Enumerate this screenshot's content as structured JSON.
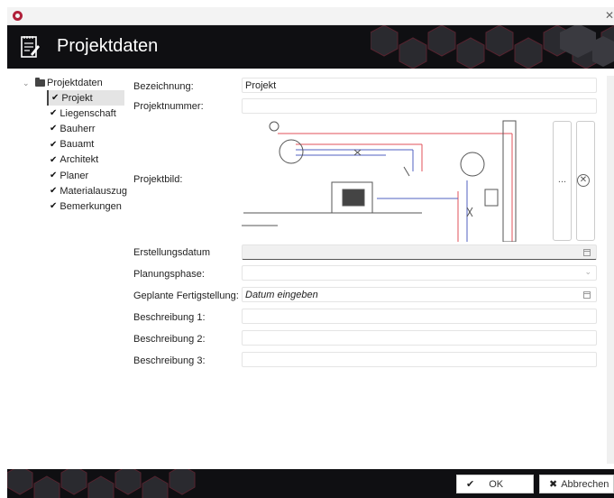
{
  "window": {
    "close_glyph": "✕"
  },
  "header": {
    "title": "Projektdaten"
  },
  "tree": {
    "root_label": "Projektdaten",
    "items": [
      {
        "label": "Projekt"
      },
      {
        "label": "Liegenschaft"
      },
      {
        "label": "Bauherr"
      },
      {
        "label": "Bauamt"
      },
      {
        "label": "Architekt"
      },
      {
        "label": "Planer"
      },
      {
        "label": "Materialauszug"
      },
      {
        "label": "Bemerkungen"
      }
    ]
  },
  "form": {
    "bezeichnung": {
      "label": "Bezeichnung:",
      "value": "Projekt"
    },
    "projektnummer": {
      "label": "Projektnummer:",
      "value": ""
    },
    "projektbild": {
      "label": "Projektbild:",
      "browse_label": "...",
      "remove_glyph": "✕"
    },
    "erstellungsdatum": {
      "label": "Erstellungsdatum",
      "value": ""
    },
    "planungsphase": {
      "label": "Planungsphase:",
      "value": ""
    },
    "fertigstellung": {
      "label": "Geplante Fertigstellung:",
      "value": "Datum eingeben"
    },
    "beschreibung1": {
      "label": "Beschreibung 1:",
      "value": ""
    },
    "beschreibung2": {
      "label": "Beschreibung 2:",
      "value": ""
    },
    "beschreibung3": {
      "label": "Beschreibung 3:",
      "value": ""
    }
  },
  "footer": {
    "ok_label": "OK",
    "cancel_label": "Abbrechen",
    "ok_icon": "✔",
    "cancel_icon": "✖"
  },
  "icons": {
    "tree_check": "check-icon",
    "folder": "folder-icon",
    "calendar": "calendar-icon"
  },
  "colors": {
    "header_bg": "#0f0f12",
    "accent": "#b0203a"
  }
}
